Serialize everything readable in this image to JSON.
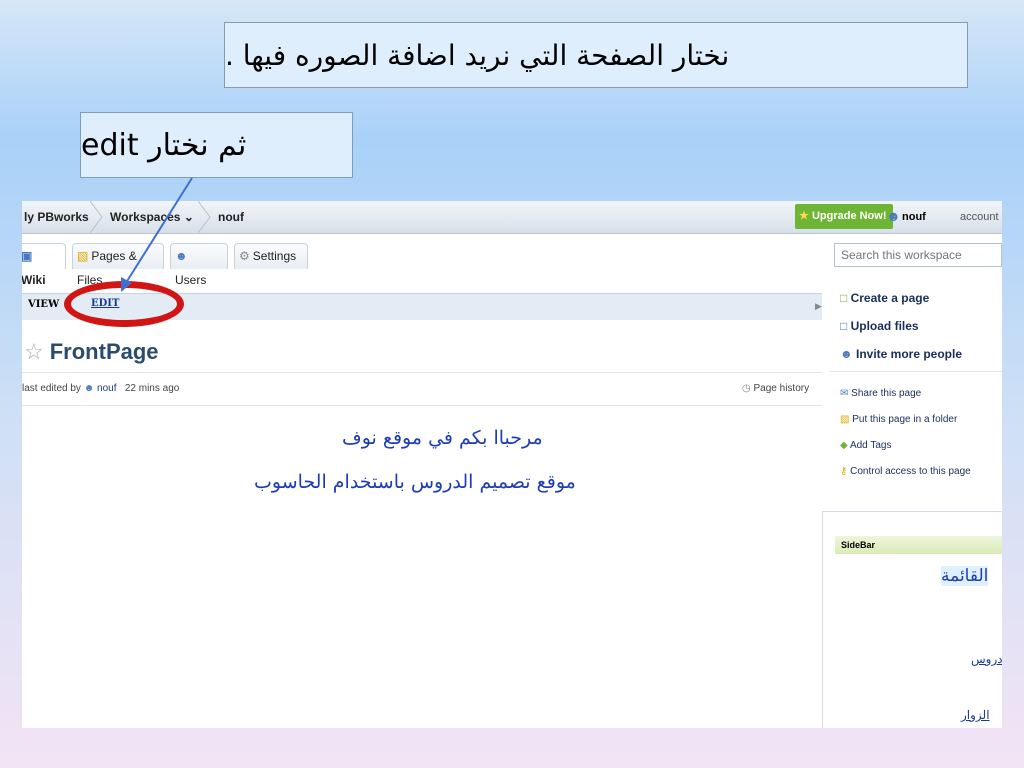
{
  "instructions": {
    "step1": "نختار الصفحة التي نريد اضافة الصوره فيها .",
    "step2": "ثم نختار edit"
  },
  "topbar": {
    "brand": "ly PBworks",
    "workspaces": "Workspaces ⌄",
    "workspace_name": "nouf",
    "upgrade": "Upgrade Now!",
    "user": "nouf",
    "account": "account"
  },
  "tabs": [
    {
      "label": "Wiki",
      "icon": "wiki-icon"
    },
    {
      "label": "Pages & Files",
      "icon": "folder-icon"
    },
    {
      "label": "Users",
      "icon": "user-icon"
    },
    {
      "label": "Settings",
      "icon": "gear-icon"
    }
  ],
  "search": {
    "placeholder": "Search this workspace"
  },
  "viewbar": {
    "view": "VIEW",
    "edit": "EDIT"
  },
  "page": {
    "title": "FrontPage",
    "edited_prefix": "last edited by",
    "edited_user": "nouf",
    "edited_time": "22 mins ago",
    "history": "Page history",
    "content_line1": "مرحباا بكم في موقع نوف",
    "content_line2": "موقع تصميم الدروس باستخدام الحاسوب"
  },
  "sidebar": {
    "actions": [
      "Create a page",
      "Upload files",
      "Invite more people"
    ],
    "links": [
      "Share this page",
      "Put this page in a folder",
      "Add Tags",
      "Control access to this page"
    ],
    "box_title": "SideBar",
    "menu_title": "القائمة",
    "menu_links": [
      "دروس",
      "الزوار"
    ]
  },
  "colors": {
    "highlight": "#d11515",
    "arrow": "#3f6fd1",
    "upgrade": "#6fb535"
  }
}
